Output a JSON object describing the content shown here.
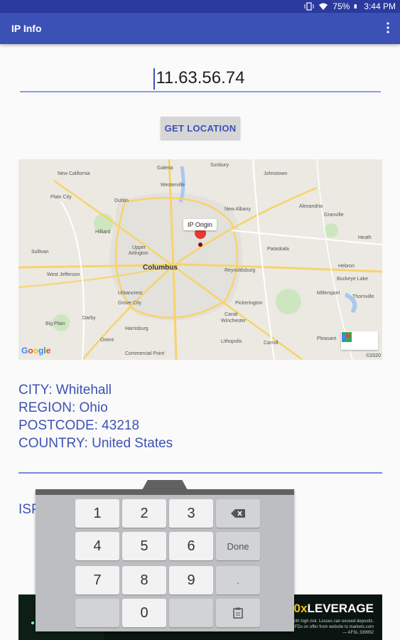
{
  "status_bar": {
    "battery": "75%",
    "time": "3:44 PM"
  },
  "app": {
    "title": "IP Info",
    "menu_icon": "overflow-menu-icon"
  },
  "ip_input": {
    "value": "11.63.56.74"
  },
  "get_location_button": {
    "label": "GET LOCATION"
  },
  "map": {
    "marker_label": "IP Origin",
    "provider": "Google",
    "copyright": "©2020",
    "places": [
      "Westerville",
      "New California",
      "Galena",
      "Sunbury",
      "Plain City",
      "Dublin",
      "New Albany",
      "Alexandria",
      "Johnstown",
      "Granville",
      "Hilliard",
      "Upper Arlington",
      "Pataskala",
      "Heath",
      "Sullivan",
      "West Jefferson",
      "Columbus",
      "Reynoldsburg",
      "Hebron",
      "Buckeye Lake",
      "Urbancrest",
      "Grove City",
      "Canal Winchester",
      "Pickerington",
      "Millersport",
      "Thornville",
      "Big Plain",
      "Harrisburg",
      "Darby",
      "Orient",
      "Commercial Point",
      "Lithopolis",
      "Carroll",
      "Pleasant"
    ]
  },
  "info": {
    "city": "CITY: Whitehall",
    "region": "REGION: Ohio",
    "postcode": "POSTCODE: 43218",
    "country": "COUNTRY: United States",
    "isp": "ISP"
  },
  "ad": {
    "headline_num": "20x",
    "headline_text": "LEVERAGE",
    "fine": "Trade with high risk. Losses can exceed deposits. Forex & CFDs on offer from website to markets.com — AFSL 339952"
  },
  "keyboard": {
    "keys": [
      [
        "1",
        "2",
        "3",
        "backspace"
      ],
      [
        "4",
        "5",
        "6",
        "Done"
      ],
      [
        "7",
        "8",
        "9",
        "."
      ],
      [
        "",
        "0",
        "",
        "clipboard"
      ]
    ]
  },
  "colors": {
    "primary": "#3c51b5",
    "statusbar": "#2a3a9e",
    "divider": "#7a86d6"
  }
}
